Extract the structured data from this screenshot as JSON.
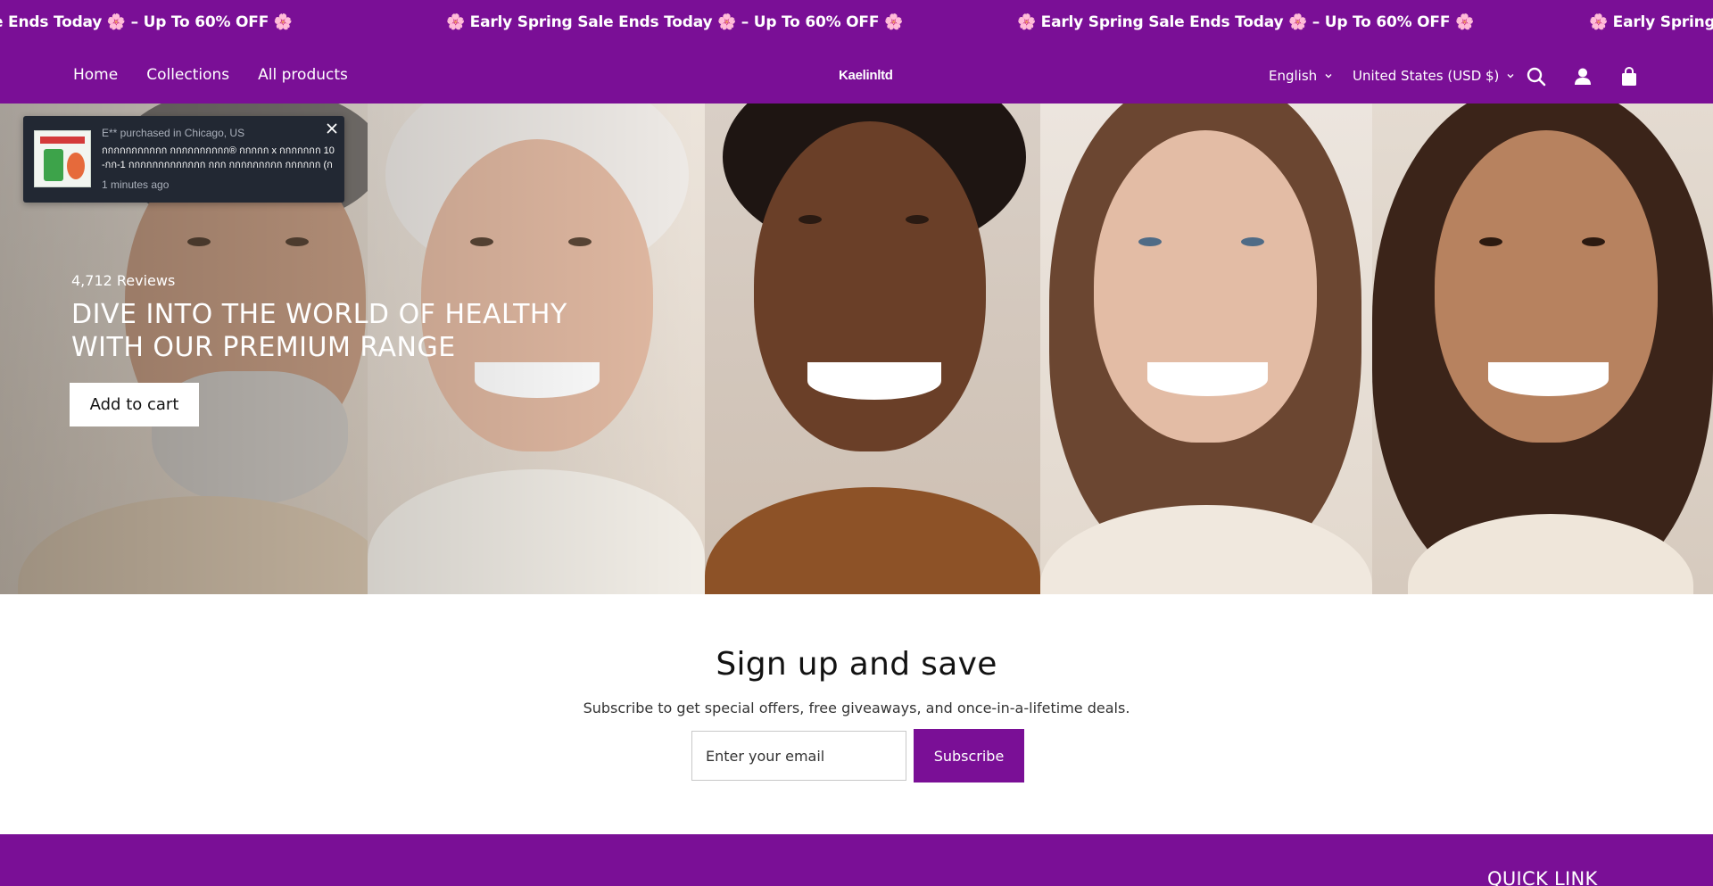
{
  "announcement": {
    "text": "🌸 Early Spring Sale Ends Today 🌸 – Up To 60% OFF 🌸",
    "fragment_left": "e Ends Today 🌸 – Up To 60% OFF 🌸",
    "fragment_right": "🌸 Early Spring Sal"
  },
  "header": {
    "nav": [
      "Home",
      "Collections",
      "All products"
    ],
    "logo": "Kaelinltd",
    "language": "English",
    "currency": "United States (USD $)",
    "icons": [
      "search-icon",
      "account-icon",
      "cart-icon"
    ]
  },
  "popup": {
    "buyer": "E** purchased in Chicago, US",
    "product": "กกกกกกกกกกก กกกกกกกกกก® กกกกก x กกกกกกก 10-กก-1 กกกกกกกกกกกกก กกก กกกกกกกกก กกกกกก (กกกกก กâกกก…",
    "time": "1 minutes ago"
  },
  "hero": {
    "reviews": "4,712 Reviews",
    "title": "DIVE INTO THE WORLD OF HEALTHY WITH OUR PREMIUM RANGE",
    "button": "Add to cart"
  },
  "newsletter": {
    "title": "Sign up and save",
    "subtitle": "Subscribe to get special offers, free giveaways, and once-in-a-lifetime deals.",
    "placeholder": "Enter your email",
    "button": "Subscribe"
  },
  "footer": {
    "heading": "QUICK LINK"
  },
  "colors": {
    "brand": "#7a0f96",
    "popup_bg": "#222833"
  }
}
